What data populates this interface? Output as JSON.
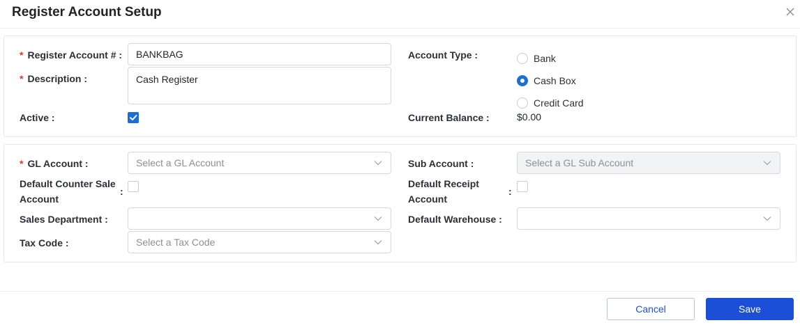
{
  "dialog": {
    "title": "Register Account Setup"
  },
  "setup": {
    "register_account_label": "Register Account #",
    "register_account_value": "BANKBAG",
    "description_label": "Description",
    "description_value": "Cash Register",
    "active_label": "Active",
    "active_checked": true,
    "account_type_label": "Account Type",
    "account_type_options": [
      "Bank",
      "Cash Box",
      "Credit Card"
    ],
    "account_type_selected": "Cash Box",
    "current_balance_label": "Current Balance",
    "current_balance_value": "$0.00"
  },
  "gl": {
    "gl_account_label": "GL Account",
    "gl_account_placeholder": "Select a GL Account",
    "sub_account_label": "Sub Account",
    "sub_account_placeholder": "Select a GL Sub Account",
    "default_counter_sale_label_1": "Default Counter Sale",
    "default_counter_sale_label_2": "Account",
    "default_counter_sale_checked": false,
    "default_receipt_label_1": "Default Receipt",
    "default_receipt_label_2": "Account",
    "default_receipt_checked": false,
    "sales_department_label": "Sales Department",
    "sales_department_value": "",
    "default_warehouse_label": "Default Warehouse",
    "default_warehouse_value": "",
    "tax_code_label": "Tax Code",
    "tax_code_placeholder": "Select a Tax Code"
  },
  "footer": {
    "cancel_label": "Cancel",
    "save_label": "Save"
  },
  "colors": {
    "primary": "#1d4ed8",
    "checkbox_blue": "#1c6ed4",
    "required": "#e0392b"
  },
  "punct": {
    "required_mark": "*",
    "colon": ":"
  }
}
